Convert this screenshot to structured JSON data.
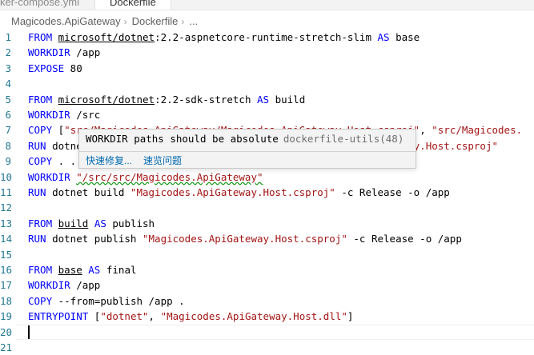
{
  "tabs": [
    {
      "label": "ker-compose.yml"
    },
    {
      "label": "Dockerfile"
    }
  ],
  "breadcrumb": {
    "items": [
      "Magicodes.ApiGateway",
      "Dockerfile",
      "..."
    ],
    "separator": "›"
  },
  "editor": {
    "lines": [
      {
        "num": "1",
        "html": "<span class='kw'>FROM</span> <span class='img'>microsoft/dotnet</span>:2.2-aspnetcore-runtime-stretch-slim <span class='kw'>AS</span> base"
      },
      {
        "num": "2",
        "html": "<span class='kw'>WORKDIR</span> /app"
      },
      {
        "num": "3",
        "html": "<span class='kw'>EXPOSE</span> 80"
      },
      {
        "num": "4",
        "html": ""
      },
      {
        "num": "5",
        "html": "<span class='kw'>FROM</span> <span class='img'>microsoft/dotnet</span>:2.2-sdk-stretch <span class='kw'>AS</span> build"
      },
      {
        "num": "6",
        "html": "<span class='kw'>WORKDIR</span> /src"
      },
      {
        "num": "7",
        "html": "<span class='kw'>COPY</span> [<span class='str'>\"src/Magicodes.ApiGateway/Magicodes.ApiGateway.Host.csproj\"</span>, <span class='str'>\"src/Magicodes.</span>"
      },
      {
        "num": "8",
        "html": "<span class='kw'>RUN</span> dotnet restore <span class='str'>\"src/Magicodes.ApiGateway/Magicodes.ApiGateway.Host.csproj\"</span>"
      },
      {
        "num": "9",
        "html": "<span class='kw'>COPY</span> . ."
      },
      {
        "num": "10",
        "html": "<span class='kw'>WORKDIR</span> <span class='str squig'>\"/src/src/Magicodes.ApiGateway\"</span>"
      },
      {
        "num": "11",
        "html": "<span class='kw'>RUN</span> dotnet build <span class='str'>\"Magicodes.ApiGateway.Host.csproj\"</span> -c Release -o /app"
      },
      {
        "num": "12",
        "html": ""
      },
      {
        "num": "13",
        "html": "<span class='kw'>FROM</span> <span class='img'>build</span> <span class='kw'>AS</span> publish"
      },
      {
        "num": "14",
        "html": "<span class='kw'>RUN</span> dotnet publish <span class='str'>\"Magicodes.ApiGateway.Host.csproj\"</span> -c Release -o /app"
      },
      {
        "num": "15",
        "html": ""
      },
      {
        "num": "16",
        "html": "<span class='kw'>FROM</span> <span class='img'>base</span> <span class='kw'>AS</span> final"
      },
      {
        "num": "17",
        "html": "<span class='kw'>WORKDIR</span> /app"
      },
      {
        "num": "18",
        "html": "<span class='kw'>COPY</span> --from=publish /app ."
      },
      {
        "num": "19",
        "html": "<span class='kw'>ENTRYPOINT</span> [<span class='str'>\"dotnet\"</span>, <span class='str'>\"Magicodes.ApiGateway.Host.dll\"</span>]"
      },
      {
        "num": "20",
        "html": ""
      },
      {
        "num": "21",
        "html": ""
      }
    ]
  },
  "hover": {
    "message": "WORKDIR paths should be absolute",
    "source": "dockerfile-utils(48)",
    "quick_fix": "快速修复...",
    "peek_problem": "速览问题"
  },
  "colors": {
    "keyword": "#0000ff",
    "string": "#a31515",
    "line_number": "#237893",
    "link": "#006ab1",
    "warning_squiggle": "#1e9b1e"
  }
}
